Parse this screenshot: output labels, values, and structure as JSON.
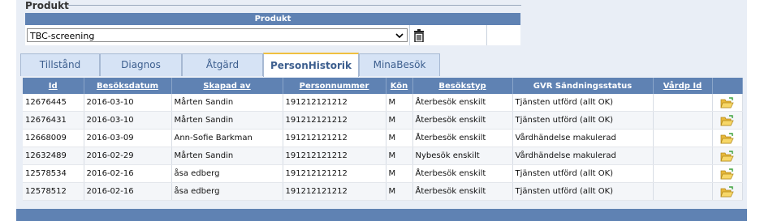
{
  "produkt": {
    "legend": "Produkt",
    "header": "Produkt",
    "selected_value": "TBC-screening"
  },
  "tabs": [
    {
      "label": "Tillstånd",
      "active": false
    },
    {
      "label": "Diagnos",
      "active": false
    },
    {
      "label": "Åtgärd",
      "active": false
    },
    {
      "label": "PersonHistorik",
      "active": true
    },
    {
      "label": "MinaBesök",
      "active": false
    }
  ],
  "grid": {
    "columns": [
      "Id",
      "Besöksdatum",
      "Skapad av",
      "Personnummer",
      "Kön",
      "Besökstyp",
      "GVR Sändningsstatus",
      "Vårdp Id",
      ""
    ],
    "rows": [
      [
        "12676445",
        "2016-03-10",
        "Mårten Sandin",
        "191212121212",
        "M",
        "Återbesök enskilt",
        "Tjänsten utförd (allt OK)",
        ""
      ],
      [
        "12676431",
        "2016-03-10",
        "Mårten Sandin",
        "191212121212",
        "M",
        "Återbesök enskilt",
        "Tjänsten utförd (allt OK)",
        ""
      ],
      [
        "12668009",
        "2016-03-09",
        "Ann-Sofie Barkman",
        "191212121212",
        "M",
        "Återbesök enskilt",
        "Vårdhändelse makulerad",
        ""
      ],
      [
        "12632489",
        "2016-02-29",
        "Mårten Sandin",
        "191212121212",
        "M",
        "Nybesök enskilt",
        "Vårdhändelse makulerad",
        ""
      ],
      [
        "12578534",
        "2016-02-16",
        "åsa edberg",
        "191212121212",
        "M",
        "Återbesök enskilt",
        "Tjänsten utförd (allt OK)",
        ""
      ],
      [
        "12578512",
        "2016-02-16",
        "åsa edberg",
        "191212121212",
        "M",
        "Återbesök enskilt",
        "Tjänsten utförd (allt OK)",
        ""
      ]
    ]
  },
  "icons": {
    "select_arrow": "chevron-down-icon",
    "delete": "trash-icon",
    "row_action": "open-folder-icon"
  },
  "colors": {
    "header_blue": "#5f82b3",
    "tab_bg": "#d6e3f5",
    "active_tab_border": "#f0c040",
    "folder_yellow": "#f2c94c"
  }
}
